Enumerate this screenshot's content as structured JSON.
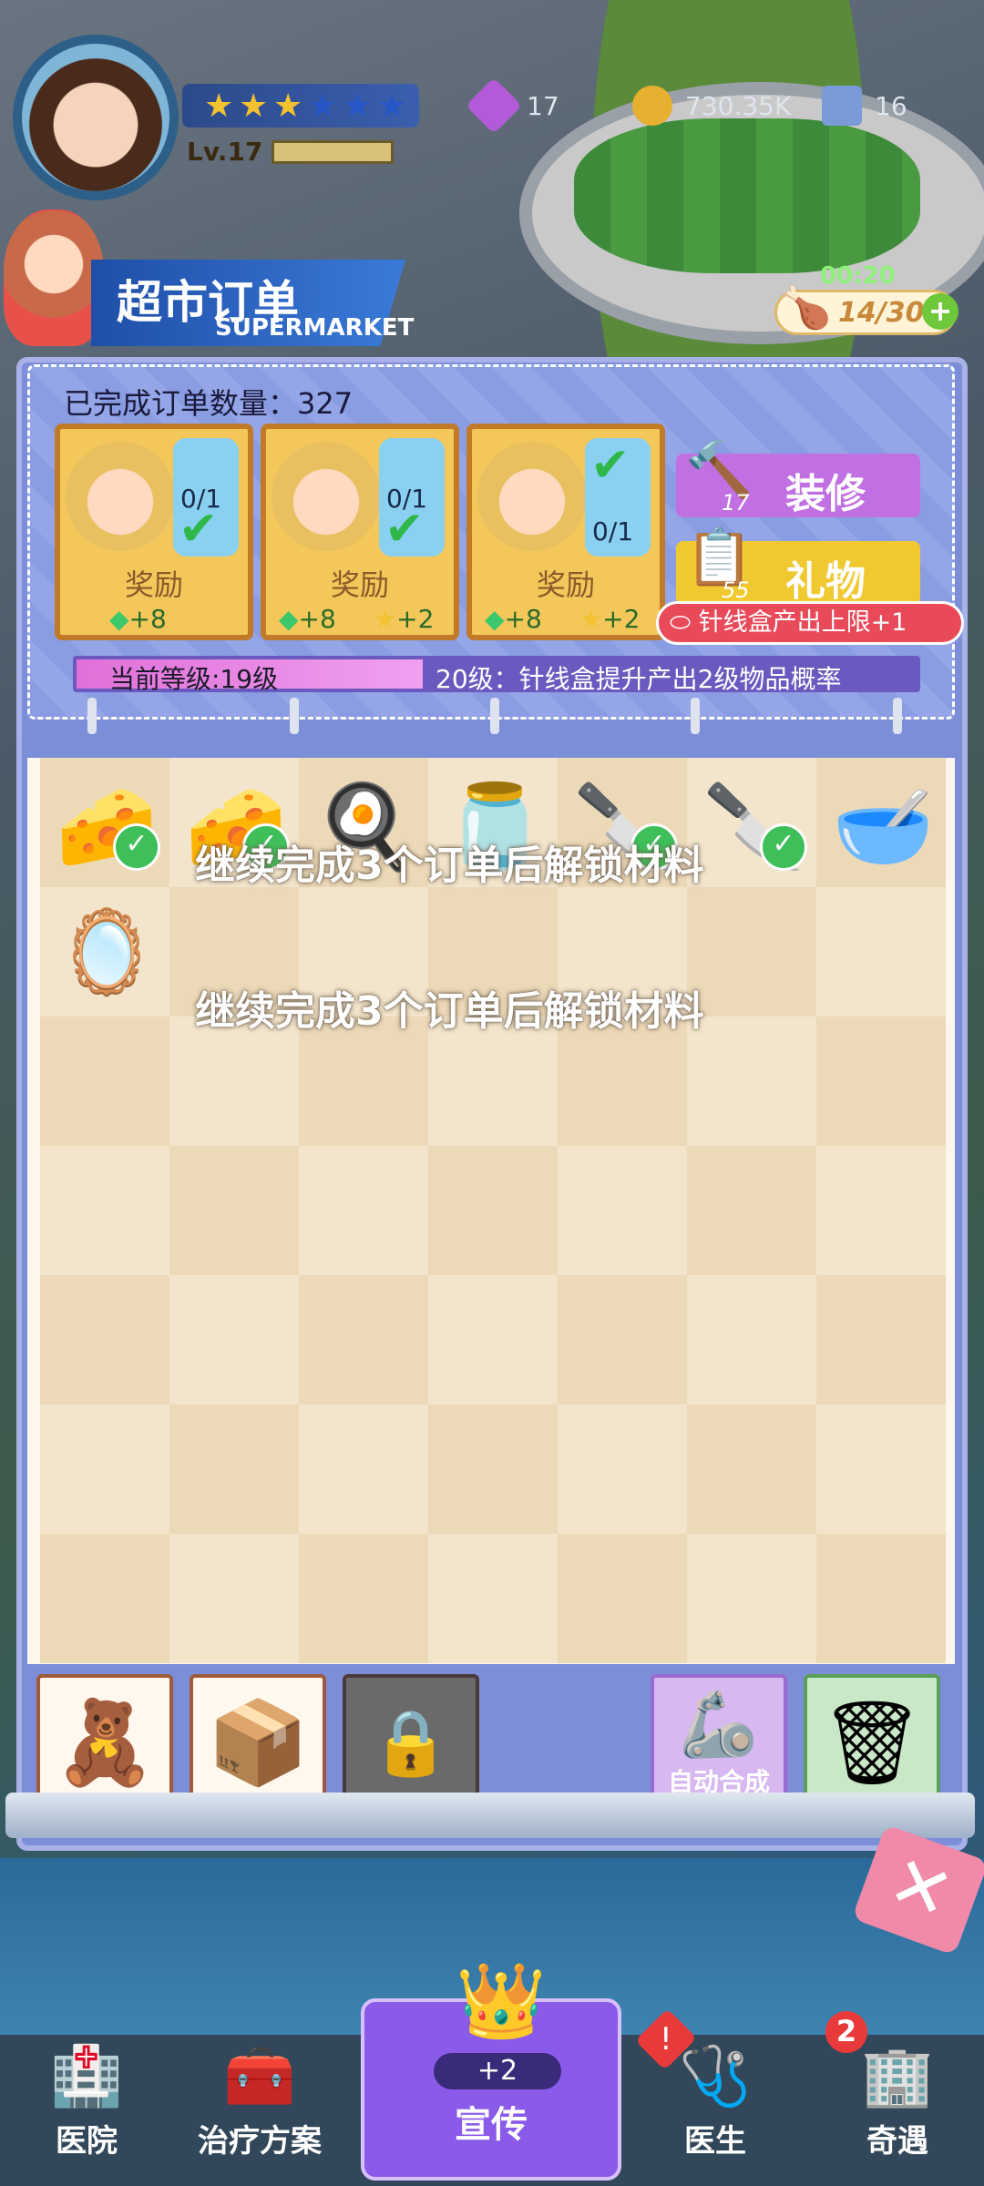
{
  "header": {
    "level_label": "Lv.17",
    "stars_filled": 3,
    "stars_total": 6,
    "resources": [
      {
        "icon": "gem-icon",
        "value": "17",
        "color": "#b35ad8"
      },
      {
        "icon": "coin-icon",
        "value": "730.35K",
        "color": "#e8b030"
      },
      {
        "icon": "ticket-icon",
        "value": "16",
        "color": "#7a9ad8"
      }
    ]
  },
  "title": {
    "main": "超市订单",
    "sub": "SUPERMARKET"
  },
  "energy": {
    "timer": "00:20",
    "count": "14/30",
    "plus": "+"
  },
  "orders": {
    "completed_label": "已完成订单数量：327",
    "cards": [
      {
        "progress": "0/1",
        "reward_label": "奖励",
        "r1": "+8",
        "r2": ""
      },
      {
        "progress": "0/1",
        "reward_label": "奖励",
        "r1": "+8",
        "r2": "+2"
      },
      {
        "progress": "0/1",
        "reward_label": "奖励",
        "r1": "+8",
        "r2": "+2"
      }
    ],
    "renovate": {
      "label": "装修",
      "count": "17"
    },
    "gift": {
      "label": "礼物",
      "count": "55"
    },
    "tooltip": "针线盒产出上限+1",
    "level_current": "当前等级:19级",
    "level_next": "20级：针线盒提升产出2级物品概率",
    "level_progress": 0.4
  },
  "board": {
    "unlock_msg_1": "继续完成3个订单后解锁材料",
    "unlock_msg_2": "继续完成3个订单后解锁材料"
  },
  "bottom_tools": {
    "auto_merge": "自动合成"
  },
  "nav": {
    "hospital": "医院",
    "plan": "治疗方案",
    "promo": "宣传",
    "promo_plus": "+2",
    "doctor": "医生",
    "encounter": "奇遇",
    "encounter_badge": "2"
  }
}
